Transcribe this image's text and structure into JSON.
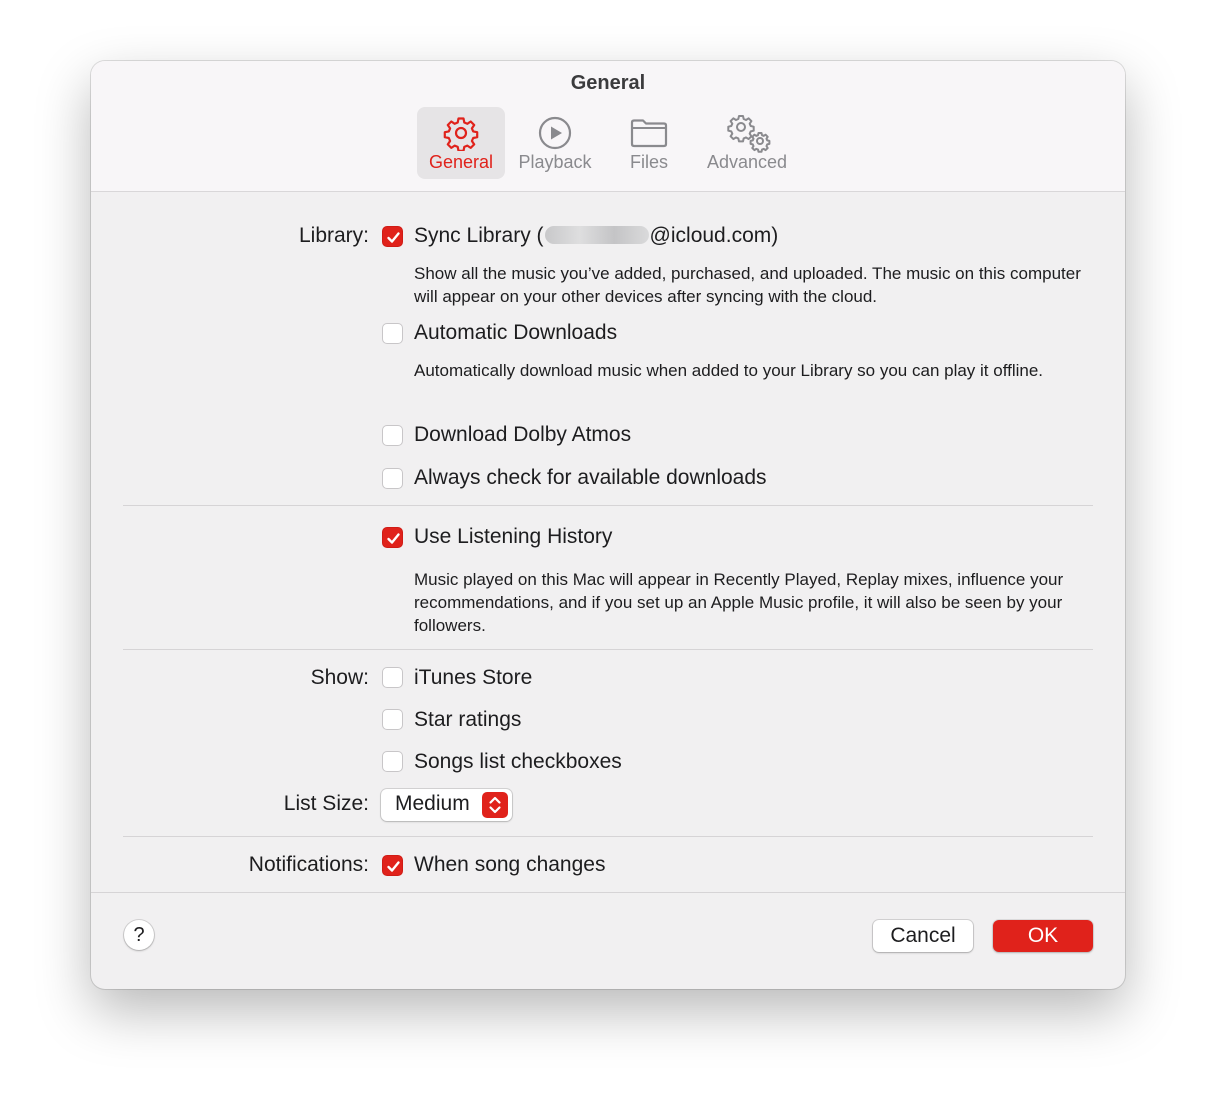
{
  "window": {
    "title": "General"
  },
  "tabs": [
    {
      "label": "General",
      "icon": "gear-icon",
      "active": true
    },
    {
      "label": "Playback",
      "icon": "play-circle-icon",
      "active": false
    },
    {
      "label": "Files",
      "icon": "folder-icon",
      "active": false
    },
    {
      "label": "Advanced",
      "icon": "gears-icon",
      "active": false
    }
  ],
  "library": {
    "label": "Library:",
    "sync": {
      "label_prefix": "Sync Library (",
      "label_suffix": "@icloud.com)",
      "checked": true,
      "description": "Show all the music you’ve added, purchased, and uploaded. The music on this computer will appear on your other devices after syncing with the cloud."
    },
    "auto_downloads": {
      "label": "Automatic Downloads",
      "checked": false,
      "description": "Automatically download music when added to your Library so you can play it offline."
    },
    "dolby": {
      "label": "Download Dolby Atmos",
      "checked": false
    },
    "always_check": {
      "label": "Always check for available downloads",
      "checked": false
    }
  },
  "history": {
    "label": "Use Listening History",
    "checked": true,
    "description": "Music played on this Mac will appear in Recently Played, Replay mixes, influence your recommendations, and if you set up an Apple Music profile, it will also be seen by your followers."
  },
  "show": {
    "label": "Show:",
    "itunes_store": {
      "label": "iTunes Store",
      "checked": false
    },
    "star_ratings": {
      "label": "Star ratings",
      "checked": false
    },
    "song_checkboxes": {
      "label": "Songs list checkboxes",
      "checked": false
    }
  },
  "list_size": {
    "label": "List Size:",
    "value": "Medium"
  },
  "notifications": {
    "label": "Notifications:",
    "song_changes": {
      "label": "When song changes",
      "checked": true
    }
  },
  "footer": {
    "help": "?",
    "cancel": "Cancel",
    "ok": "OK"
  },
  "colors": {
    "accent": "#e0221b",
    "window_bg": "#f1f0f1",
    "toolbar_bg": "#f8f6f8"
  }
}
